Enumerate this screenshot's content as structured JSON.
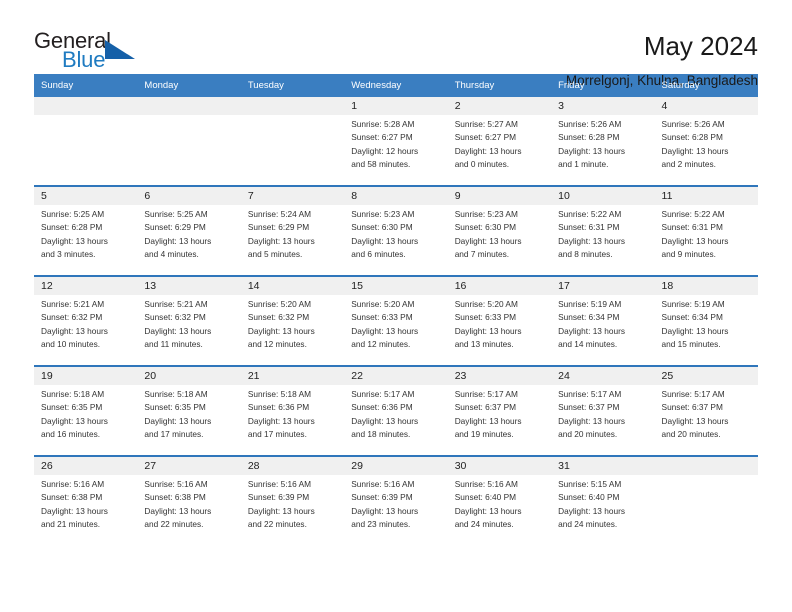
{
  "brand": {
    "name_part1": "General",
    "name_part2": "Blue",
    "triangle_color": "#1560a8",
    "blue_text_color": "#1f7bc1"
  },
  "header": {
    "title": "May 2024",
    "location": "Morrelgonj, Khulna, Bangladesh"
  },
  "theme": {
    "header_bar_color": "#3a7ec1",
    "week_separator_color": "#2f76bb",
    "daynum_band_color": "#f0f0f0"
  },
  "weekdays": [
    "Sunday",
    "Monday",
    "Tuesday",
    "Wednesday",
    "Thursday",
    "Friday",
    "Saturday"
  ],
  "labels": {
    "sunrise_prefix": "Sunrise: ",
    "sunset_prefix": "Sunset: ",
    "daylight_prefix": "Daylight: "
  },
  "weeks": [
    [
      {
        "day": "",
        "sunrise": "",
        "sunset": "",
        "daylight_a": "",
        "daylight_b": ""
      },
      {
        "day": "",
        "sunrise": "",
        "sunset": "",
        "daylight_a": "",
        "daylight_b": ""
      },
      {
        "day": "",
        "sunrise": "",
        "sunset": "",
        "daylight_a": "",
        "daylight_b": ""
      },
      {
        "day": "1",
        "sunrise": "Sunrise: 5:28 AM",
        "sunset": "Sunset: 6:27 PM",
        "daylight_a": "Daylight: 12 hours",
        "daylight_b": "and 58 minutes."
      },
      {
        "day": "2",
        "sunrise": "Sunrise: 5:27 AM",
        "sunset": "Sunset: 6:27 PM",
        "daylight_a": "Daylight: 13 hours",
        "daylight_b": "and 0 minutes."
      },
      {
        "day": "3",
        "sunrise": "Sunrise: 5:26 AM",
        "sunset": "Sunset: 6:28 PM",
        "daylight_a": "Daylight: 13 hours",
        "daylight_b": "and 1 minute."
      },
      {
        "day": "4",
        "sunrise": "Sunrise: 5:26 AM",
        "sunset": "Sunset: 6:28 PM",
        "daylight_a": "Daylight: 13 hours",
        "daylight_b": "and 2 minutes."
      }
    ],
    [
      {
        "day": "5",
        "sunrise": "Sunrise: 5:25 AM",
        "sunset": "Sunset: 6:28 PM",
        "daylight_a": "Daylight: 13 hours",
        "daylight_b": "and 3 minutes."
      },
      {
        "day": "6",
        "sunrise": "Sunrise: 5:25 AM",
        "sunset": "Sunset: 6:29 PM",
        "daylight_a": "Daylight: 13 hours",
        "daylight_b": "and 4 minutes."
      },
      {
        "day": "7",
        "sunrise": "Sunrise: 5:24 AM",
        "sunset": "Sunset: 6:29 PM",
        "daylight_a": "Daylight: 13 hours",
        "daylight_b": "and 5 minutes."
      },
      {
        "day": "8",
        "sunrise": "Sunrise: 5:23 AM",
        "sunset": "Sunset: 6:30 PM",
        "daylight_a": "Daylight: 13 hours",
        "daylight_b": "and 6 minutes."
      },
      {
        "day": "9",
        "sunrise": "Sunrise: 5:23 AM",
        "sunset": "Sunset: 6:30 PM",
        "daylight_a": "Daylight: 13 hours",
        "daylight_b": "and 7 minutes."
      },
      {
        "day": "10",
        "sunrise": "Sunrise: 5:22 AM",
        "sunset": "Sunset: 6:31 PM",
        "daylight_a": "Daylight: 13 hours",
        "daylight_b": "and 8 minutes."
      },
      {
        "day": "11",
        "sunrise": "Sunrise: 5:22 AM",
        "sunset": "Sunset: 6:31 PM",
        "daylight_a": "Daylight: 13 hours",
        "daylight_b": "and 9 minutes."
      }
    ],
    [
      {
        "day": "12",
        "sunrise": "Sunrise: 5:21 AM",
        "sunset": "Sunset: 6:32 PM",
        "daylight_a": "Daylight: 13 hours",
        "daylight_b": "and 10 minutes."
      },
      {
        "day": "13",
        "sunrise": "Sunrise: 5:21 AM",
        "sunset": "Sunset: 6:32 PM",
        "daylight_a": "Daylight: 13 hours",
        "daylight_b": "and 11 minutes."
      },
      {
        "day": "14",
        "sunrise": "Sunrise: 5:20 AM",
        "sunset": "Sunset: 6:32 PM",
        "daylight_a": "Daylight: 13 hours",
        "daylight_b": "and 12 minutes."
      },
      {
        "day": "15",
        "sunrise": "Sunrise: 5:20 AM",
        "sunset": "Sunset: 6:33 PM",
        "daylight_a": "Daylight: 13 hours",
        "daylight_b": "and 12 minutes."
      },
      {
        "day": "16",
        "sunrise": "Sunrise: 5:20 AM",
        "sunset": "Sunset: 6:33 PM",
        "daylight_a": "Daylight: 13 hours",
        "daylight_b": "and 13 minutes."
      },
      {
        "day": "17",
        "sunrise": "Sunrise: 5:19 AM",
        "sunset": "Sunset: 6:34 PM",
        "daylight_a": "Daylight: 13 hours",
        "daylight_b": "and 14 minutes."
      },
      {
        "day": "18",
        "sunrise": "Sunrise: 5:19 AM",
        "sunset": "Sunset: 6:34 PM",
        "daylight_a": "Daylight: 13 hours",
        "daylight_b": "and 15 minutes."
      }
    ],
    [
      {
        "day": "19",
        "sunrise": "Sunrise: 5:18 AM",
        "sunset": "Sunset: 6:35 PM",
        "daylight_a": "Daylight: 13 hours",
        "daylight_b": "and 16 minutes."
      },
      {
        "day": "20",
        "sunrise": "Sunrise: 5:18 AM",
        "sunset": "Sunset: 6:35 PM",
        "daylight_a": "Daylight: 13 hours",
        "daylight_b": "and 17 minutes."
      },
      {
        "day": "21",
        "sunrise": "Sunrise: 5:18 AM",
        "sunset": "Sunset: 6:36 PM",
        "daylight_a": "Daylight: 13 hours",
        "daylight_b": "and 17 minutes."
      },
      {
        "day": "22",
        "sunrise": "Sunrise: 5:17 AM",
        "sunset": "Sunset: 6:36 PM",
        "daylight_a": "Daylight: 13 hours",
        "daylight_b": "and 18 minutes."
      },
      {
        "day": "23",
        "sunrise": "Sunrise: 5:17 AM",
        "sunset": "Sunset: 6:37 PM",
        "daylight_a": "Daylight: 13 hours",
        "daylight_b": "and 19 minutes."
      },
      {
        "day": "24",
        "sunrise": "Sunrise: 5:17 AM",
        "sunset": "Sunset: 6:37 PM",
        "daylight_a": "Daylight: 13 hours",
        "daylight_b": "and 20 minutes."
      },
      {
        "day": "25",
        "sunrise": "Sunrise: 5:17 AM",
        "sunset": "Sunset: 6:37 PM",
        "daylight_a": "Daylight: 13 hours",
        "daylight_b": "and 20 minutes."
      }
    ],
    [
      {
        "day": "26",
        "sunrise": "Sunrise: 5:16 AM",
        "sunset": "Sunset: 6:38 PM",
        "daylight_a": "Daylight: 13 hours",
        "daylight_b": "and 21 minutes."
      },
      {
        "day": "27",
        "sunrise": "Sunrise: 5:16 AM",
        "sunset": "Sunset: 6:38 PM",
        "daylight_a": "Daylight: 13 hours",
        "daylight_b": "and 22 minutes."
      },
      {
        "day": "28",
        "sunrise": "Sunrise: 5:16 AM",
        "sunset": "Sunset: 6:39 PM",
        "daylight_a": "Daylight: 13 hours",
        "daylight_b": "and 22 minutes."
      },
      {
        "day": "29",
        "sunrise": "Sunrise: 5:16 AM",
        "sunset": "Sunset: 6:39 PM",
        "daylight_a": "Daylight: 13 hours",
        "daylight_b": "and 23 minutes."
      },
      {
        "day": "30",
        "sunrise": "Sunrise: 5:16 AM",
        "sunset": "Sunset: 6:40 PM",
        "daylight_a": "Daylight: 13 hours",
        "daylight_b": "and 24 minutes."
      },
      {
        "day": "31",
        "sunrise": "Sunrise: 5:15 AM",
        "sunset": "Sunset: 6:40 PM",
        "daylight_a": "Daylight: 13 hours",
        "daylight_b": "and 24 minutes."
      },
      {
        "day": "",
        "sunrise": "",
        "sunset": "",
        "daylight_a": "",
        "daylight_b": ""
      }
    ]
  ]
}
